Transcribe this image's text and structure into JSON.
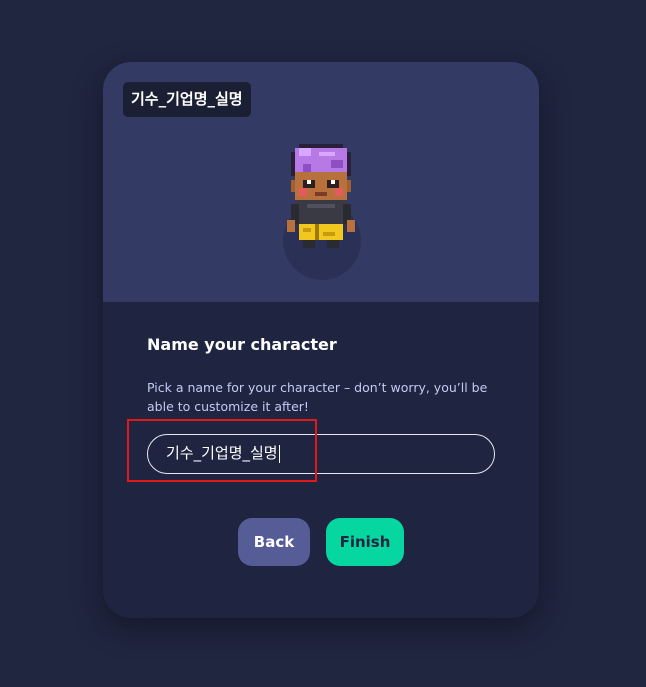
{
  "character": {
    "tag": "기수_기업명_실명",
    "avatar_icon": "pixel-character-avatar"
  },
  "form": {
    "title": "Name your character",
    "description": "Pick a name for your character – don’t worry, you’ll be able to customize it after!",
    "name_value": "기수_기업명_실명"
  },
  "buttons": {
    "back": "Back",
    "finish": "Finish"
  },
  "colors": {
    "page_bg": "#202540",
    "preview_bg": "#333a64",
    "finish_bg": "#06d6a0",
    "back_bg": "#555c96",
    "highlight": "#e11919"
  }
}
